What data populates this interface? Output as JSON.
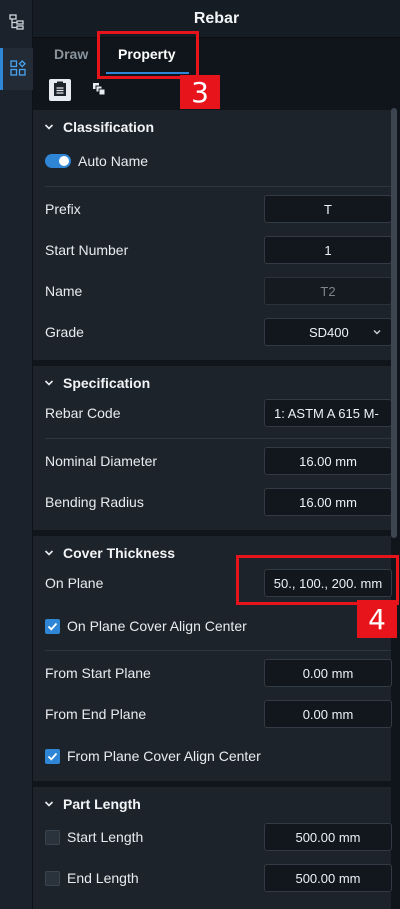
{
  "panel": {
    "title": "Rebar"
  },
  "tabs": [
    {
      "label": "Draw"
    },
    {
      "label": "Property"
    }
  ],
  "annotations": {
    "tab_marker": "3",
    "field_marker": "4"
  },
  "sections": {
    "classification": {
      "title": "Classification",
      "auto_name_label": "Auto Name",
      "prefix_label": "Prefix",
      "prefix_value": "T",
      "start_number_label": "Start Number",
      "start_number_value": "1",
      "name_label": "Name",
      "name_value": "T2",
      "grade_label": "Grade",
      "grade_value": "SD400"
    },
    "specification": {
      "title": "Specification",
      "rebar_code_label": "Rebar Code",
      "rebar_code_value": "1: ASTM A 615 M-",
      "nominal_diameter_label": "Nominal Diameter",
      "nominal_diameter_value": "16.00 mm",
      "bending_radius_label": "Bending Radius",
      "bending_radius_value": "16.00 mm"
    },
    "cover_thickness": {
      "title": "Cover Thickness",
      "on_plane_label": "On Plane",
      "on_plane_value": "50., 100., 200. mm",
      "on_plane_align_label": "On Plane Cover Align Center",
      "from_start_plane_label": "From Start Plane",
      "from_start_plane_value": "0.00 mm",
      "from_end_plane_label": "From End Plane",
      "from_end_plane_value": "0.00 mm",
      "from_plane_align_label": "From Plane Cover Align Center"
    },
    "part_length": {
      "title": "Part Length",
      "start_length_label": "Start Length",
      "start_length_value": "500.00 mm",
      "end_length_label": "End Length",
      "end_length_value": "500.00 mm"
    }
  },
  "colors": {
    "accent": "#2f86d6",
    "callout": "#e8141c"
  },
  "icons": [
    "tree-icon",
    "property-grid-icon",
    "clipboard-icon",
    "copy-layers-icon",
    "chevron-down-icon",
    "checkmark-icon"
  ]
}
